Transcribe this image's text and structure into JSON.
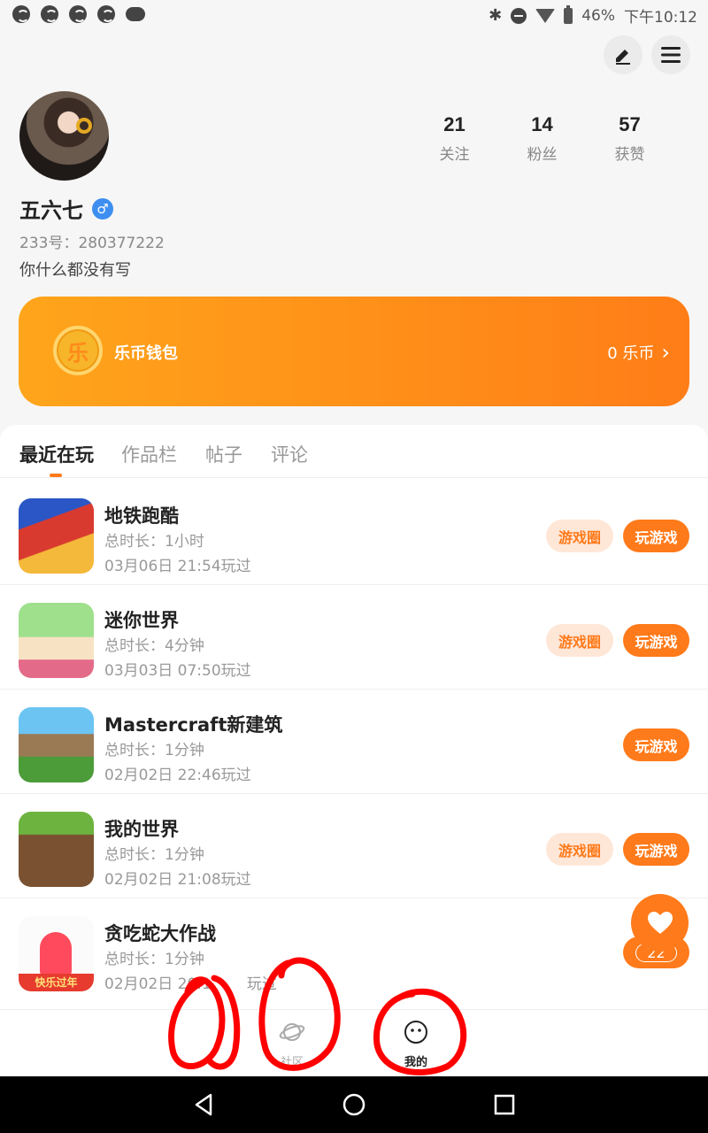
{
  "status_bar": {
    "battery": "46%",
    "time": "下午10:12",
    "icons": [
      "app-notify-icon",
      "app-notify-icon",
      "app-notify-icon",
      "app-notify-icon",
      "cloud-icon",
      "bluetooth-icon",
      "do-not-disturb-icon",
      "wifi-icon",
      "battery-icon"
    ]
  },
  "header": {
    "edit_icon": "edit-pencil-icon",
    "menu_icon": "menu-icon"
  },
  "profile": {
    "nickname": "五六七",
    "gender_symbol": "♂",
    "uid": "233号：280377222",
    "bio": "你什么都没有写",
    "stats": [
      {
        "value": "21",
        "label": "关注"
      },
      {
        "value": "14",
        "label": "粉丝"
      },
      {
        "value": "57",
        "label": "获赞"
      }
    ]
  },
  "wallet": {
    "coin_char": "乐",
    "label": "乐币钱包",
    "value": "0 乐币",
    "arrow": "›"
  },
  "tabs": [
    {
      "label": "最近在玩",
      "active": true
    },
    {
      "label": "作品栏",
      "active": false
    },
    {
      "label": "帖子",
      "active": false
    },
    {
      "label": "评论",
      "active": false
    }
  ],
  "games": [
    {
      "title": "地铁跑酷",
      "duration": "总时长：1小时",
      "last_played": "03月06日 21:54玩过",
      "circle_label": "游戏圈",
      "play_label": "玩游戏"
    },
    {
      "title": "迷你世界",
      "duration": "总时长：4分钟",
      "last_played": "03月03日 07:50玩过",
      "circle_label": "游戏圈",
      "play_label": "玩游戏"
    },
    {
      "title": "Mastercraft新建筑",
      "duration": "总时长：1分钟",
      "last_played": "02月02日 22:46玩过",
      "play_label": "玩游戏"
    },
    {
      "title": "我的世界",
      "duration": "总时长：1分钟",
      "last_played": "02月02日 21:08玩过",
      "circle_label": "游戏圈",
      "play_label": "玩游戏"
    },
    {
      "title": "贪吃蛇大作战",
      "duration": "总时长：1分钟",
      "last_played": "02月02日 20:1",
      "last_played_tail": "玩过",
      "icon_banner": "快乐过年"
    }
  ],
  "like": {
    "count": "22",
    "icon": "heart-icon"
  },
  "bottom_nav": [
    {
      "label": "社区",
      "icon": "planet-icon",
      "active": false
    },
    {
      "label": "我的",
      "icon": "smiley-face-icon",
      "active": true
    }
  ],
  "colors": {
    "accent": "#ff7a1a",
    "wallet_gradient_start": "#ffa51b",
    "wallet_gradient_end": "#ff7d17",
    "markup_red": "#ff0000"
  }
}
